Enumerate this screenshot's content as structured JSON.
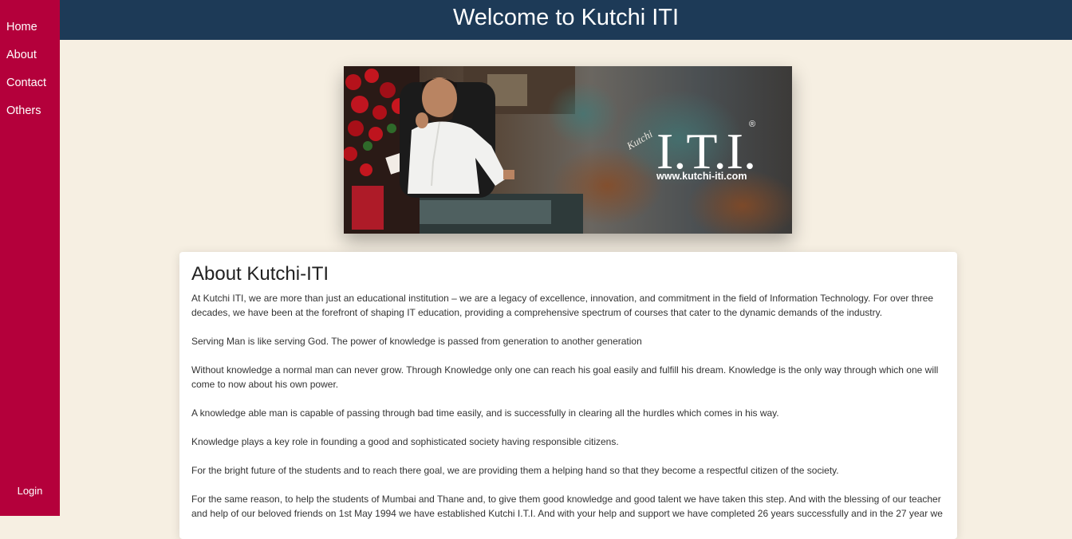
{
  "sidebar": {
    "items": [
      {
        "label": "Home"
      },
      {
        "label": "About"
      },
      {
        "label": "Contact"
      },
      {
        "label": "Others"
      }
    ],
    "login_label": "Login"
  },
  "header": {
    "title": "Welcome to Kutchi ITI"
  },
  "banner": {
    "script_text": "Kutchi",
    "logo_text": "I.T.I.",
    "registered_mark": "®",
    "url_text": "www.kutchi-iti.com"
  },
  "about": {
    "title": "About Kutchi-ITI",
    "paragraphs": [
      "At Kutchi ITI, we are more than just an educational institution – we are a legacy of excellence, innovation, and commitment in the field of Information Technology. For over three decades, we have been at the forefront of shaping IT education, providing a comprehensive spectrum of courses that cater to the dynamic demands of the industry.",
      "Serving Man is like serving God. The power of knowledge is passed from generation to another generation",
      "Without knowledge a normal man can never grow. Through Knowledge only one can reach his goal easily and fulfill his dream. Knowledge is the only way through which one will come to now about his own power.",
      "A knowledge able man is capable of passing through bad time easily, and is successfully in clearing all the hurdles which comes in his way.",
      "Knowledge plays a key role in founding a good and sophisticated society having responsible citizens.",
      "For the bright future of the students and to reach there goal, we are providing them a helping hand so that they become a respectful citizen of the society.",
      "For the same reason, to help the students of Mumbai and Thane and, to give them good knowledge and good talent we have taken this step. And with the blessing of our teacher and help of our beloved friends on 1st May 1994 we have established Kutchi I.T.I. And with your help and support we have completed 26 years successfully and in the 27 year we"
    ]
  },
  "colors": {
    "sidebar": "#b4003b",
    "header": "#1d3a57",
    "page_background": "#f6efe2"
  }
}
